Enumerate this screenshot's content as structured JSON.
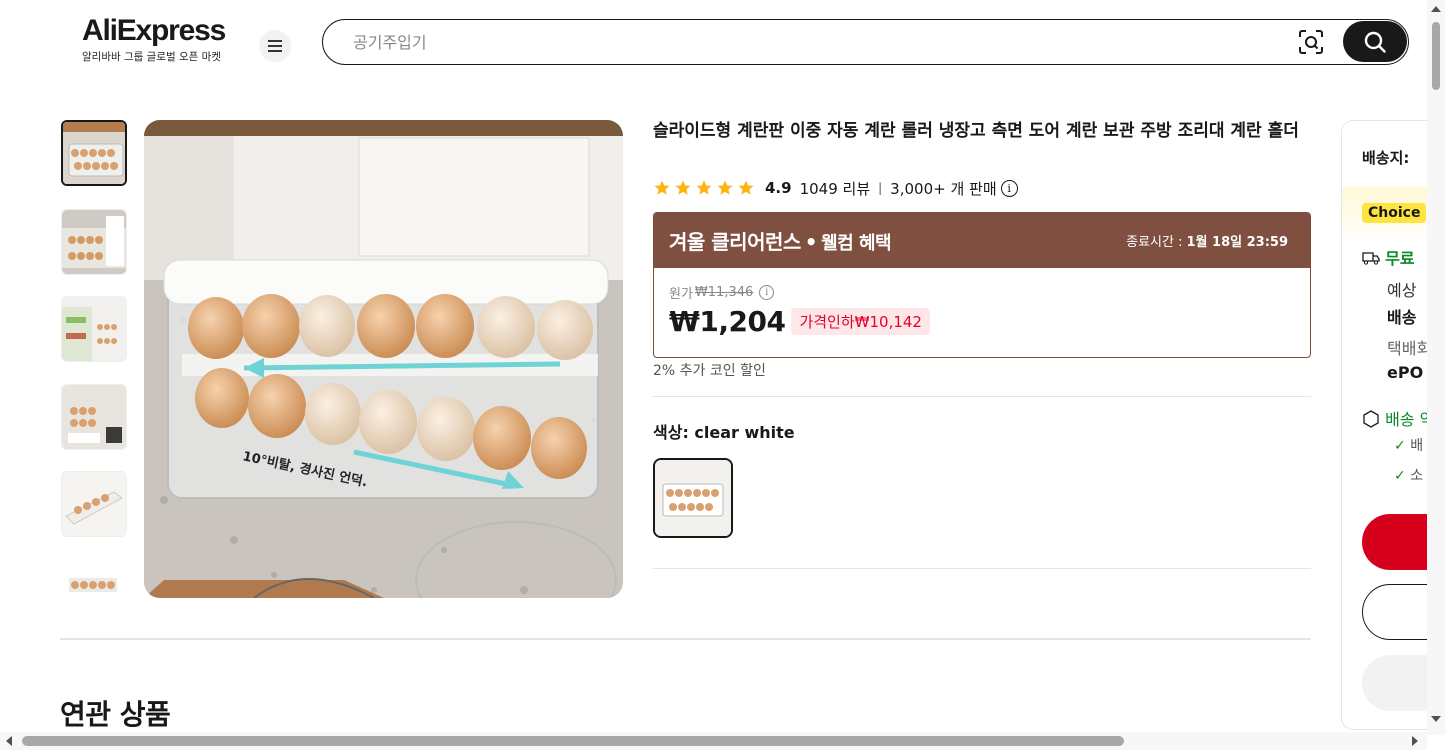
{
  "header": {
    "logo_text": "AliExpress",
    "logo_tagline": "알리바바 그룹 글로벌 오픈 마켓",
    "search_placeholder": "공기주입기"
  },
  "product": {
    "title": "슬라이드형 계란판 이중 자동 계란 롤러 냉장고 측면 도어 계란 보관 주방 조리대 계란 홀더",
    "rating": "4.9",
    "star_count": 5,
    "reviews": "1049 리뷰",
    "sold": "3,000+ 개 판매",
    "image_caption": "10°비탈, 경사진 언덕."
  },
  "promo": {
    "title_main": "겨울 클리어런스",
    "title_sub": "웰컴 혜택",
    "deadline_label": "종료시간 :",
    "deadline_value": "1월 18일 23:59",
    "original_label": "원가",
    "original_price": "₩11,346",
    "current_price": "₩1,204",
    "discount_label": "가격인하₩10,142",
    "coin_note": "2% 추가 코인 할인"
  },
  "variant": {
    "label": "색상: clear white"
  },
  "related": {
    "title": "연관 상품"
  },
  "side": {
    "ship_to": "배송지:",
    "choice_badge": "Choice",
    "free_shipping": "무료",
    "est_label": "예상",
    "delivery_label": "배송",
    "courier_label": "택배회",
    "courier_value": "ePO",
    "guarantee_label": "배송 약",
    "check_1": "배",
    "check_2": "소"
  },
  "colors": {
    "brand_red": "#d6001c",
    "promo_brown": "#7f5040",
    "star_yellow": "#fdb515",
    "choice_yellow": "#ffe33f",
    "green": "#0b8a26"
  }
}
